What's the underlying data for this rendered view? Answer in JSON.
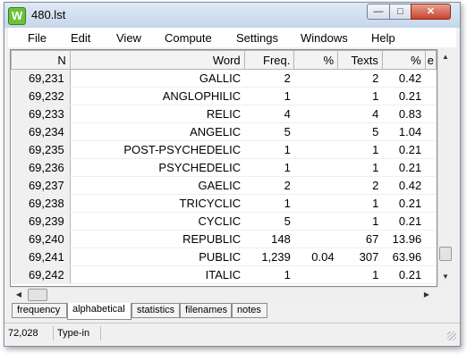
{
  "window": {
    "title": "480.lst",
    "app_icon": "W"
  },
  "title_buttons": {
    "minimize": "—",
    "maximize": "□",
    "close": "✕"
  },
  "menu": [
    "File",
    "Edit",
    "View",
    "Compute",
    "Settings",
    "Windows",
    "Help"
  ],
  "table": {
    "headers": [
      "N",
      "Word",
      "Freq.",
      "%",
      "Texts",
      "%",
      "e"
    ],
    "rows": [
      [
        "69,231",
        "GALLIC",
        "2",
        "",
        "2",
        "0.42"
      ],
      [
        "69,232",
        "ANGLOPHILIC",
        "1",
        "",
        "1",
        "0.21"
      ],
      [
        "69,233",
        "RELIC",
        "4",
        "",
        "4",
        "0.83"
      ],
      [
        "69,234",
        "ANGELIC",
        "5",
        "",
        "5",
        "1.04"
      ],
      [
        "69,235",
        "POST-PSYCHEDELIC",
        "1",
        "",
        "1",
        "0.21"
      ],
      [
        "69,236",
        "PSYCHEDELIC",
        "1",
        "",
        "1",
        "0.21"
      ],
      [
        "69,237",
        "GAELIC",
        "2",
        "",
        "2",
        "0.42"
      ],
      [
        "69,238",
        "TRICYCLIC",
        "1",
        "",
        "1",
        "0.21"
      ],
      [
        "69,239",
        "CYCLIC",
        "5",
        "",
        "1",
        "0.21"
      ],
      [
        "69,240",
        "REPUBLIC",
        "148",
        "",
        "67",
        "13.96"
      ],
      [
        "69,241",
        "PUBLIC",
        "1,239",
        "0.04",
        "307",
        "63.96"
      ],
      [
        "69,242",
        "ITALIC",
        "1",
        "",
        "1",
        "0.21"
      ]
    ]
  },
  "tabs": [
    "frequency",
    "alphabetical",
    "statistics",
    "filenames",
    "notes"
  ],
  "active_tab": "alphabetical",
  "status": {
    "count": "72,028",
    "mode": "Type-in"
  }
}
